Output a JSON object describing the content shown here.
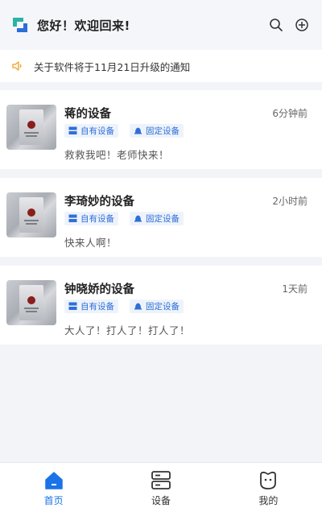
{
  "header": {
    "greeting": "您好！欢迎回来!",
    "search_icon": "search-icon",
    "add_icon": "plus-circle-icon"
  },
  "notice": {
    "text": "关于软件将于11月21日升级的通知",
    "icon": "speaker-icon"
  },
  "devices": [
    {
      "name": "蒋的设备",
      "time": "6分钟前",
      "tags": [
        "自有设备",
        "固定设备"
      ],
      "message": "救救我吧！老师快来！"
    },
    {
      "name": "李琦妙的设备",
      "time": "2小时前",
      "tags": [
        "自有设备",
        "固定设备"
      ],
      "message": "快来人啊！"
    },
    {
      "name": "钟晓娇的设备",
      "time": "1天前",
      "tags": [
        "自有设备",
        "固定设备"
      ],
      "message": "大人了！打人了！打人了！"
    }
  ],
  "tabbar": {
    "items": [
      {
        "label": "首页",
        "icon": "home-icon",
        "active": true
      },
      {
        "label": "设备",
        "icon": "server-icon",
        "active": false
      },
      {
        "label": "我的",
        "icon": "profile-icon",
        "active": false
      }
    ]
  },
  "colors": {
    "accent": "#1a73e8",
    "tag_bg": "#eef3fb",
    "tag_text": "#2e6fd8",
    "notice_icon": "#f0a020"
  }
}
